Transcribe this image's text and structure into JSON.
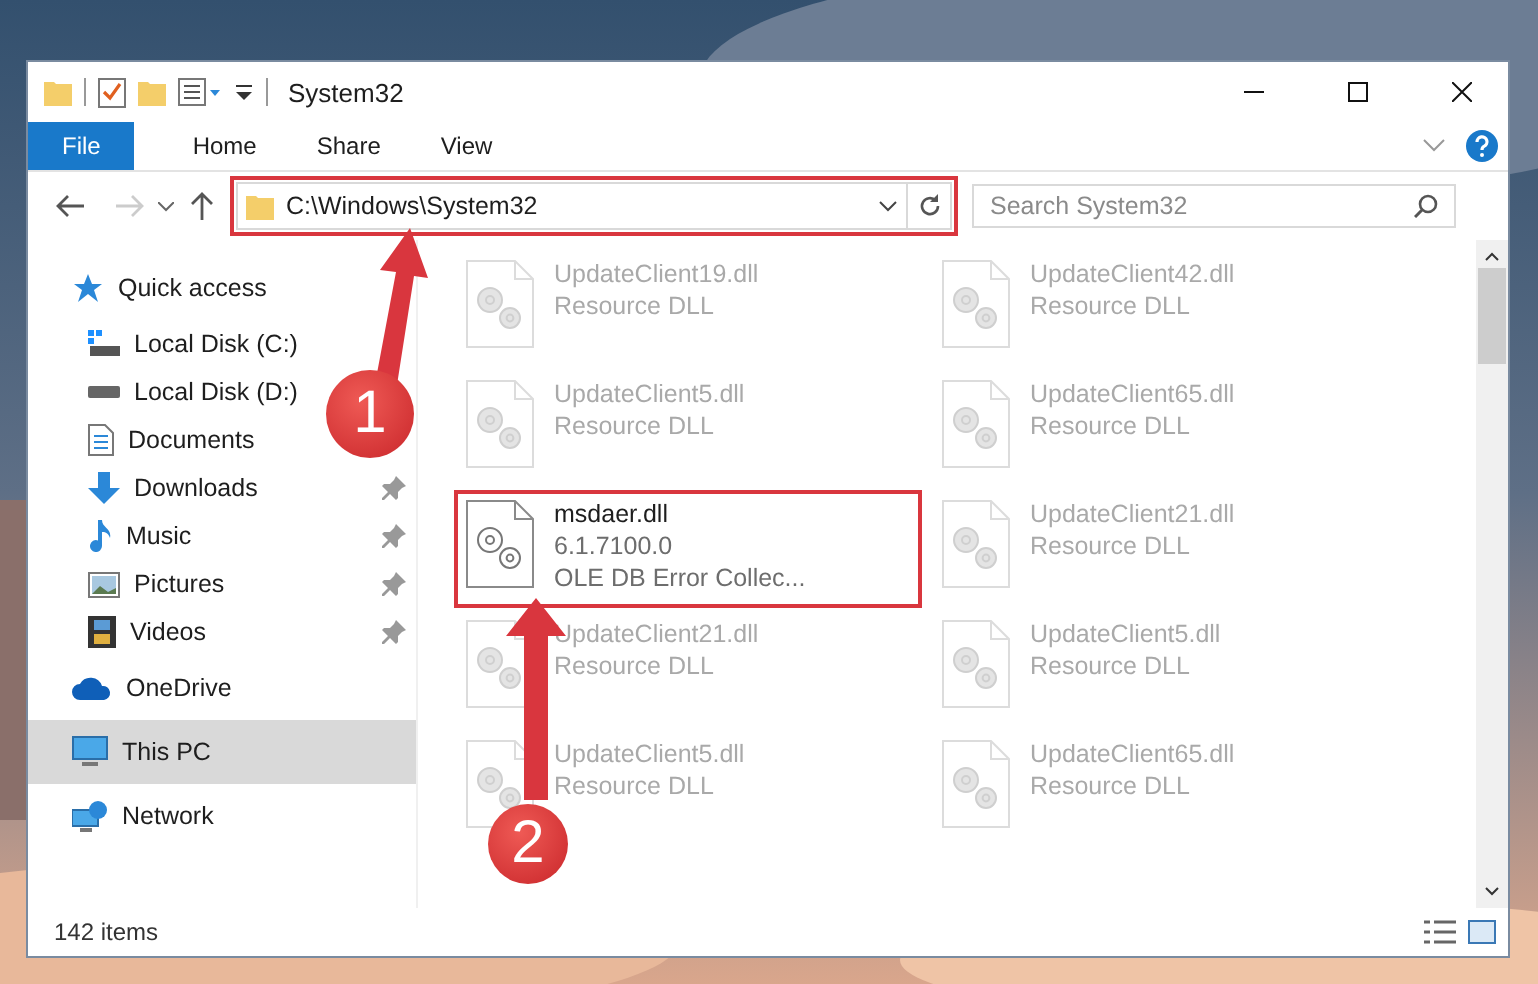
{
  "window": {
    "title": "System32"
  },
  "ribbon": {
    "tabs": [
      {
        "label": "File",
        "kind": "file"
      },
      {
        "label": "Home",
        "kind": "tab"
      },
      {
        "label": "Share",
        "kind": "tab"
      },
      {
        "label": "View",
        "kind": "tab"
      }
    ]
  },
  "address_bar": {
    "path": "C:\\Windows\\System32",
    "highlighted": true
  },
  "search": {
    "placeholder": "Search System32"
  },
  "sidebar": {
    "items": [
      {
        "label": "Quick access",
        "kind": "star",
        "selected": false,
        "children": [
          {
            "label": "Local Disk (C:)",
            "kind": "system-drive",
            "pinned": false,
            "selected": false
          },
          {
            "label": "Local Disk (D:)",
            "kind": "drive",
            "pinned": false,
            "selected": false
          },
          {
            "label": "Documents",
            "kind": "documents",
            "pinned": false,
            "selected": false
          },
          {
            "label": "Downloads",
            "kind": "downloads",
            "pinned": true,
            "selected": false
          },
          {
            "label": "Music",
            "kind": "music",
            "pinned": true,
            "selected": false
          },
          {
            "label": "Pictures",
            "kind": "pictures",
            "pinned": true,
            "selected": false
          },
          {
            "label": "Videos",
            "kind": "videos",
            "pinned": true,
            "selected": false
          }
        ]
      },
      {
        "label": "OneDrive",
        "kind": "cloud",
        "selected": false
      },
      {
        "label": "This PC",
        "kind": "pc",
        "selected": true
      },
      {
        "label": "Network",
        "kind": "network",
        "selected": false
      }
    ]
  },
  "files": [
    {
      "name": "UpdateClient19.dll",
      "details": [
        "Resource DLL"
      ],
      "faded": true,
      "highlighted": false
    },
    {
      "name": "UpdateClient42.dll",
      "details": [
        "Resource DLL"
      ],
      "faded": true,
      "highlighted": false
    },
    {
      "name": "UpdateClient5.dll",
      "details": [
        "Resource DLL"
      ],
      "faded": true,
      "highlighted": false
    },
    {
      "name": "UpdateClient65.dll",
      "details": [
        "Resource DLL"
      ],
      "faded": true,
      "highlighted": false
    },
    {
      "name": "msdaer.dll",
      "details": [
        "6.1.7100.0",
        "OLE DB Error Collec..."
      ],
      "faded": false,
      "highlighted": true
    },
    {
      "name": "UpdateClient21.dll",
      "details": [
        "Resource DLL"
      ],
      "faded": true,
      "highlighted": false
    },
    {
      "name": "UpdateClient21.dll",
      "details": [
        "Resource DLL"
      ],
      "faded": true,
      "highlighted": false
    },
    {
      "name": "UpdateClient5.dll",
      "details": [
        "Resource DLL"
      ],
      "faded": true,
      "highlighted": false
    },
    {
      "name": "UpdateClient5.dll",
      "details": [
        "Resource DLL"
      ],
      "faded": true,
      "highlighted": false
    },
    {
      "name": "UpdateClient65.dll",
      "details": [
        "Resource DLL"
      ],
      "faded": true,
      "highlighted": false
    }
  ],
  "status_bar": {
    "count": "142 items"
  },
  "annotations": [
    {
      "number": "1"
    },
    {
      "number": "2"
    }
  ]
}
